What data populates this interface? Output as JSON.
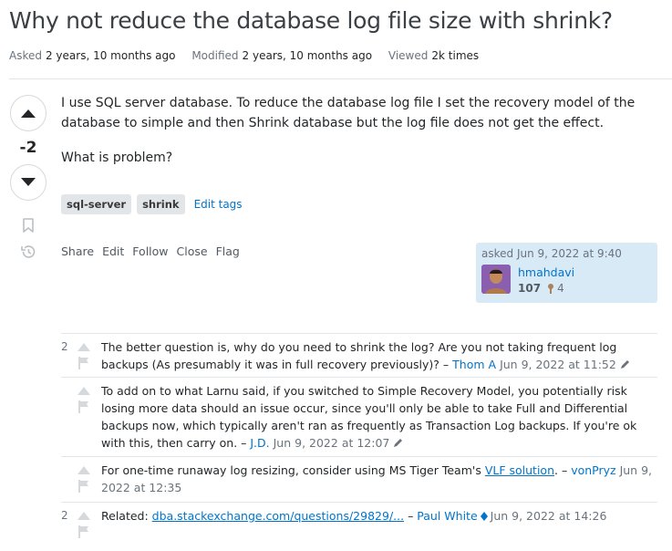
{
  "question": {
    "title": "Why not reduce the database log file size with shrink?",
    "meta": {
      "asked_label": "Asked",
      "asked_value": "2 years, 10 months ago",
      "modified_label": "Modified",
      "modified_value": "2 years, 10 months ago",
      "viewed_label": "Viewed",
      "viewed_value": "2k times"
    },
    "score": "-2",
    "body_p1": "I use SQL server database. To reduce the database log file I set the recovery model of the database to simple and then Shrink database but the log file does not get the effect.",
    "body_p2": "What is problem?",
    "tags": [
      "sql-server",
      "shrink"
    ],
    "edit_tags": "Edit tags",
    "actions": [
      "Share",
      "Edit",
      "Follow",
      "Close",
      "Flag"
    ],
    "owner": {
      "asked": "asked Jun 9, 2022 at 9:40",
      "name": "hmahdavi",
      "reputation": "107",
      "bronze": "4"
    }
  },
  "comments": [
    {
      "score": "2",
      "text": "The better question is, why do you need to shrink the log? Are you not taking frequent log backups (As presumably it was in full recovery previously)? –",
      "user": "Thom A",
      "date": "Jun 9, 2022 at 11:52"
    },
    {
      "score": "",
      "text": "To add on to what Larnu said, if you switched to Simple Recovery Model, you potentially risk losing more data should an issue occur, since you'll only be able to take Full and Differential backups now, which typically aren't ran as frequently as Transaction Log backups. If you're ok with this, then carry on. –",
      "user": "J.D.",
      "date": "Jun 9, 2022 at 12:07"
    },
    {
      "score": "",
      "text_before": "For one-time runaway log resizing, consider using MS Tiger Team's",
      "link": "VLF solution",
      "text_after": ". –",
      "user": "vonPryz",
      "date": "Jun 9, 2022 at 12:35"
    },
    {
      "score": "2",
      "text_before": "Related:",
      "link": "dba.stackexchange.com/questions/29829/...",
      "text_after": "–",
      "user": "Paul White",
      "date": "Jun 9, 2022 at 14:26"
    }
  ],
  "colors": {
    "link": "#0074cc",
    "owner_bg": "#d9eaf7",
    "tag_bg": "#e3e6e8",
    "bronze": "#ab825f",
    "moderator": "#0074cc"
  },
  "icons": [
    "upvote-icon",
    "downvote-icon",
    "bookmark-icon",
    "history-icon",
    "comment-upvote-icon",
    "flag-icon",
    "pencil-icon",
    "bronze-badge-icon",
    "moderator-diamond-icon"
  ]
}
